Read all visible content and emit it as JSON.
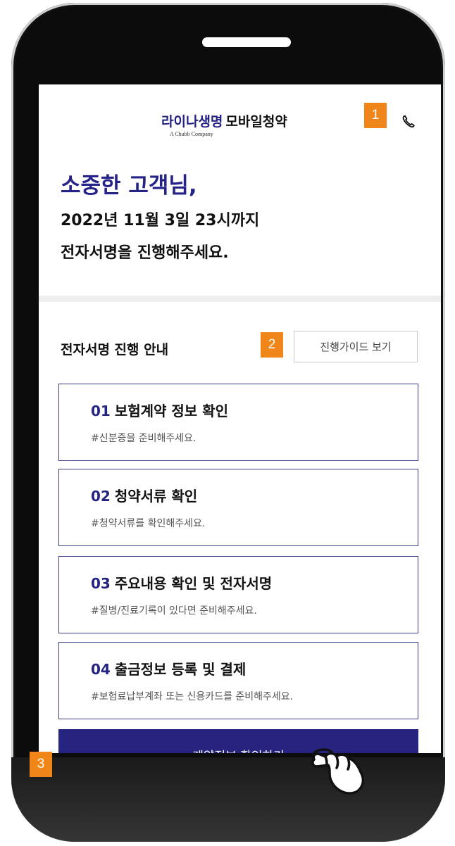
{
  "header": {
    "brand": "라이나생명",
    "title": "모바일청약",
    "subtitle": "A Chubb Company",
    "phone_icon": "phone-icon"
  },
  "greeting": {
    "title": "소중한 고객님,",
    "line1": "2022년 11월 3일 23시까지",
    "line2": "전자서명을 진행해주세요."
  },
  "guide": {
    "title": "전자서명 진행 안내",
    "button_label": "진행가이드 보기"
  },
  "steps": [
    {
      "num": "01",
      "title": "보험계약 정보 확인",
      "note": "#신분증을 준비해주세요."
    },
    {
      "num": "02",
      "title": "청약서류 확인",
      "note": "#청약서류를 확인해주세요."
    },
    {
      "num": "03",
      "title": "주요내용 확인 및 전자서명",
      "note": "#질병/진료기록이 있다면 준비해주세요."
    },
    {
      "num": "04",
      "title": "출금정보 등록 및 결제",
      "note": "#보험료납부계좌 또는 신용카드를 준비해주세요."
    }
  ],
  "cta": {
    "label": "계약정보 확인하기"
  },
  "markers": [
    "1",
    "2",
    "3"
  ],
  "colors": {
    "brand_navy": "#26247f",
    "marker_orange": "#f08519",
    "phone_frame": "#0c0c0c"
  }
}
